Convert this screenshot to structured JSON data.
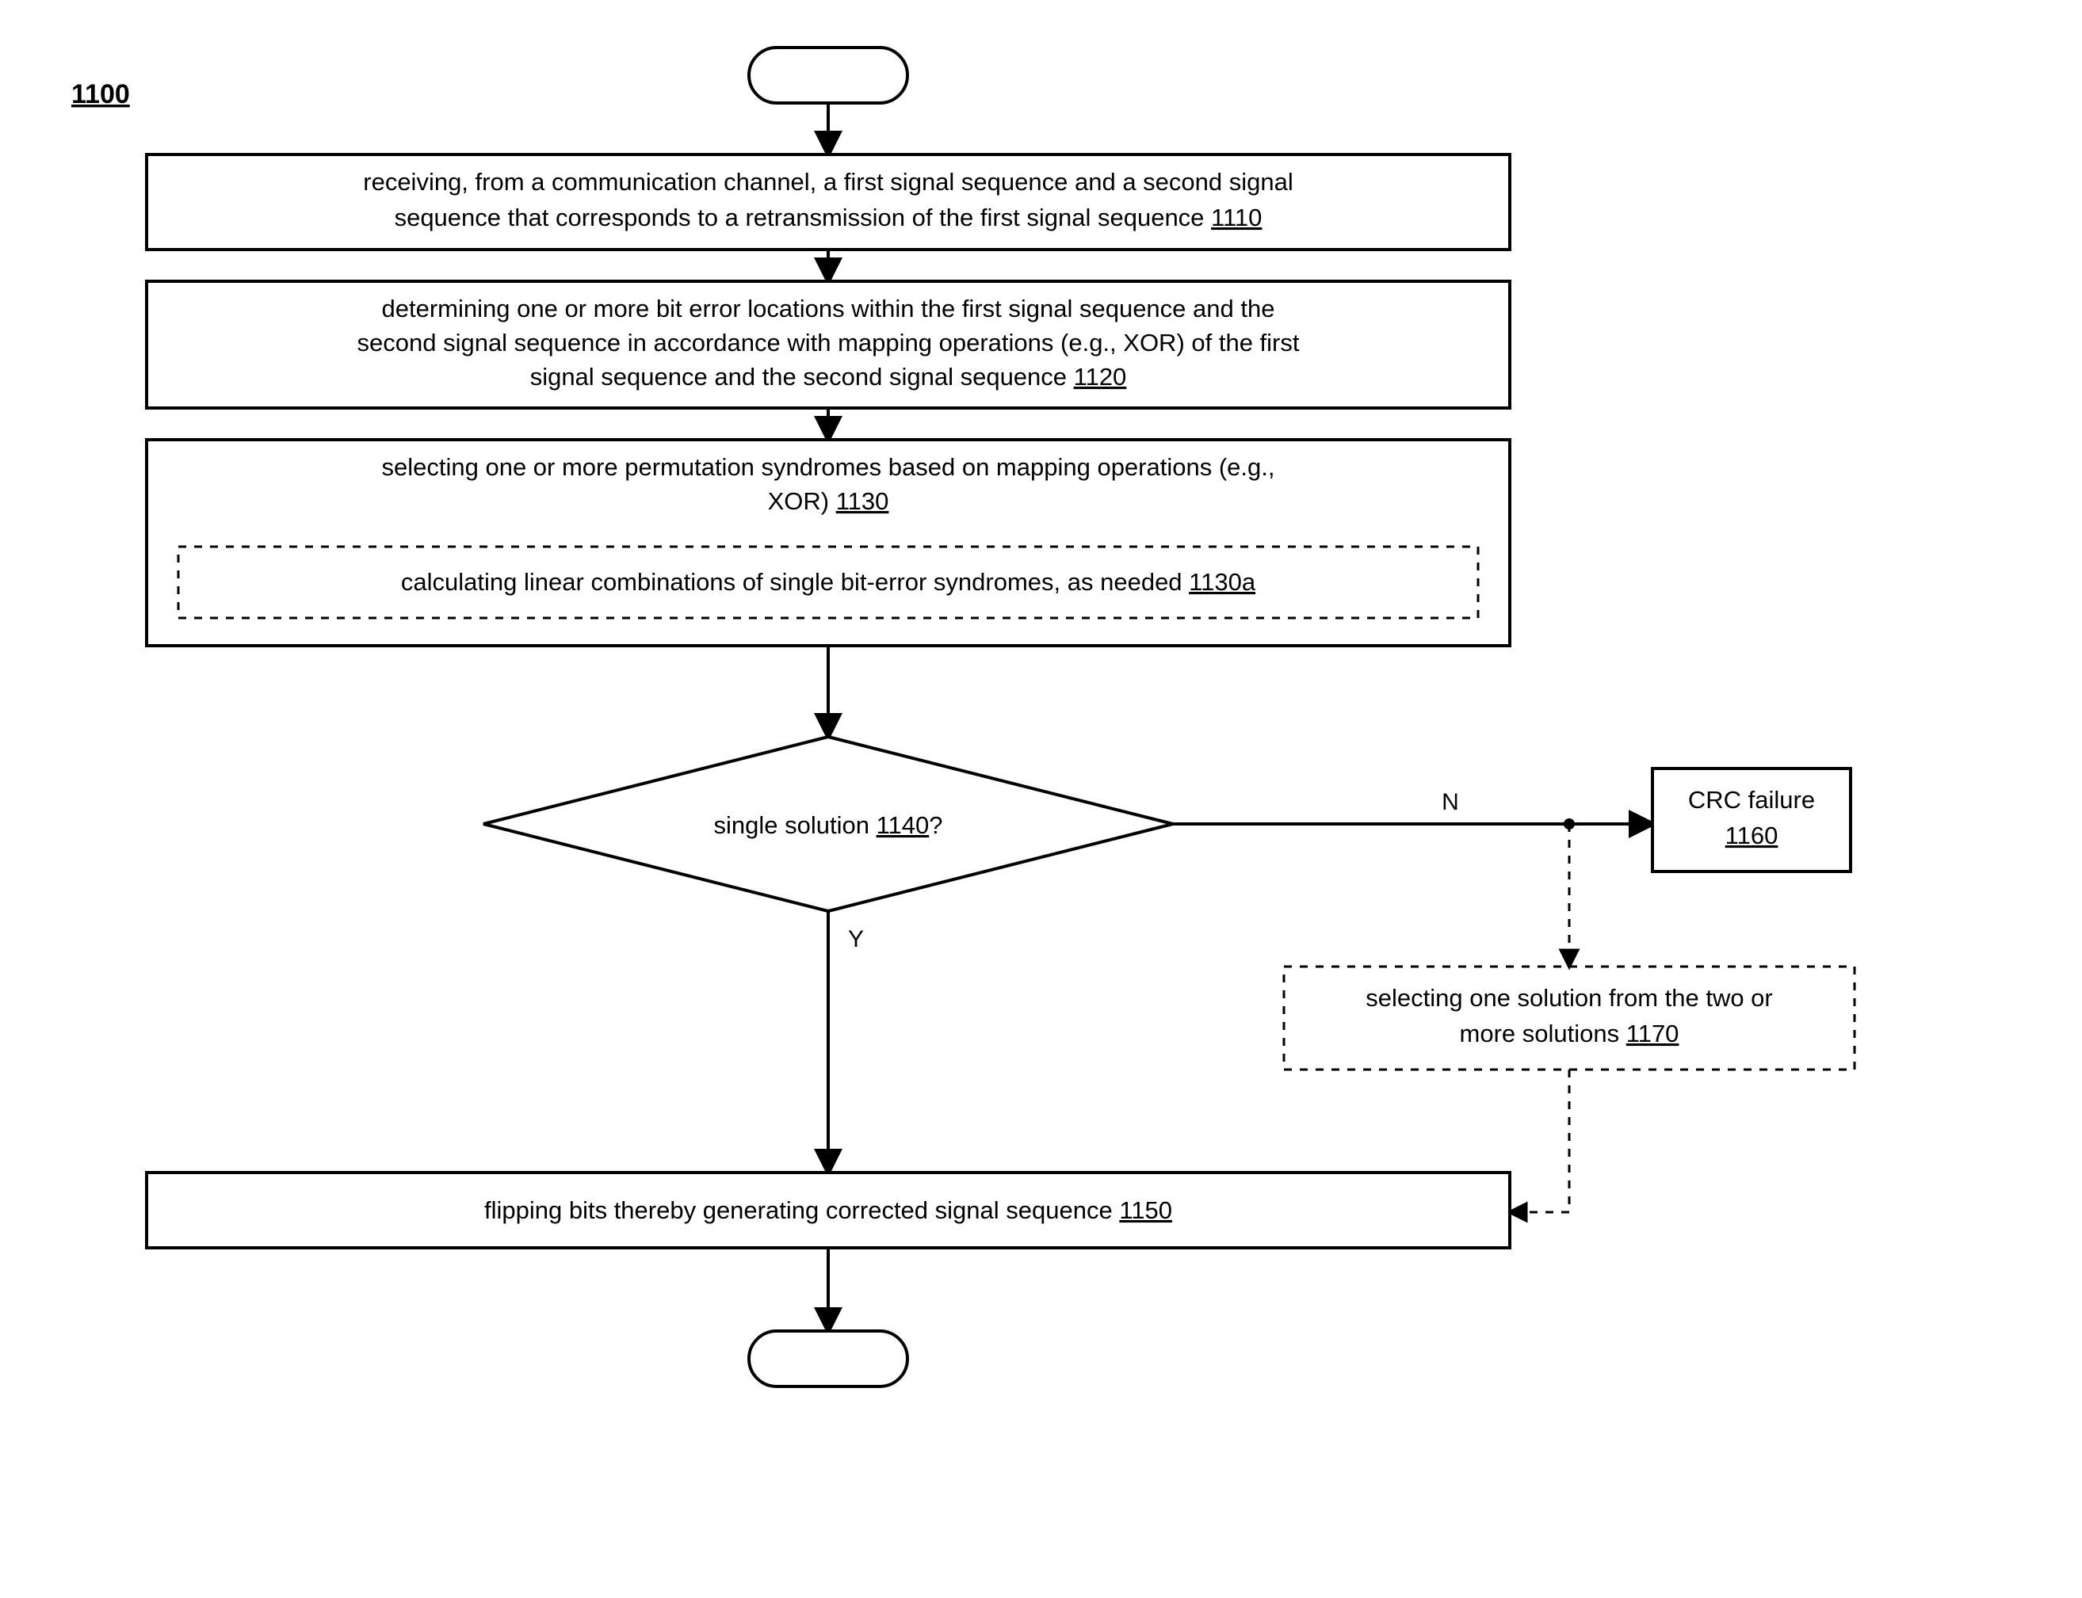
{
  "figure_label": "1100",
  "steps": {
    "s1110": {
      "line1": "receiving, from a communication channel, a first signal sequence and a second signal",
      "line2_pre": "sequence that corresponds to a retransmission of the first signal sequence ",
      "ref": "1110"
    },
    "s1120": {
      "line1": "determining one or more bit error locations within the first signal sequence and the",
      "line2": "second signal sequence in accordance with mapping operations (e.g., XOR) of the first",
      "line3_pre": "signal sequence and the second signal sequence ",
      "ref": "1120"
    },
    "s1130": {
      "line1": "selecting one or more permutation syndromes based on mapping operations (e.g.,",
      "line2_pre": "XOR) ",
      "ref": "1130"
    },
    "s1130a": {
      "line_pre": "calculating linear combinations of single bit-error syndromes, as needed ",
      "ref": "1130a"
    },
    "s1140": {
      "text_pre": "single solution ",
      "ref": "1140",
      "text_post": "?"
    },
    "s1150": {
      "line_pre": "flipping bits thereby generating corrected signal sequence ",
      "ref": "1150"
    },
    "s1160": {
      "line1": "CRC failure",
      "ref": "1160"
    },
    "s1170": {
      "line1": "selecting one solution from the two or",
      "line2_pre": "more solutions ",
      "ref": "1170"
    }
  },
  "edges": {
    "yes": "Y",
    "no": "N"
  }
}
